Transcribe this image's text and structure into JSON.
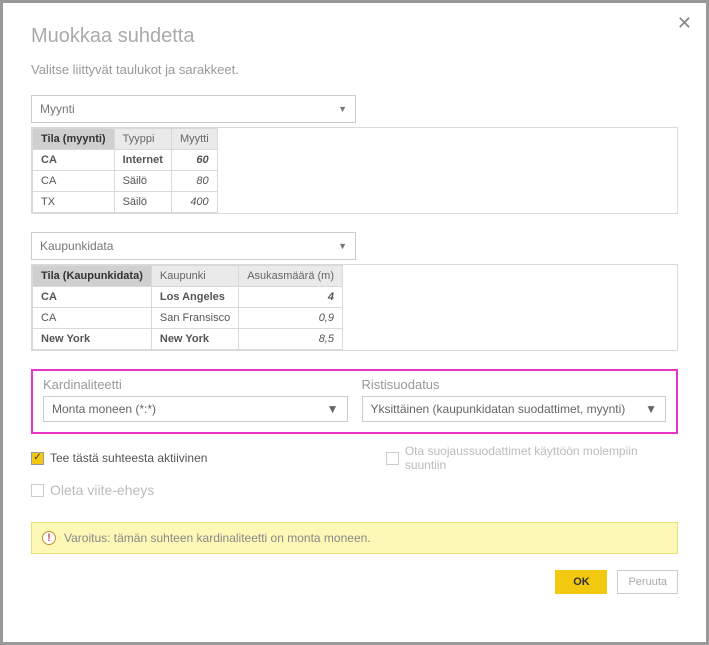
{
  "dialog": {
    "title": "Muokkaa suhdetta",
    "subtitle": "Valitse liittyvät taulukot ja sarakkeet."
  },
  "table1": {
    "dropdown": "Myynti",
    "headers": [
      "Tila (myynti)",
      "Tyyppi",
      "Myytti"
    ],
    "rows": [
      {
        "c0": "CA",
        "c1": "Internet",
        "c2": "60"
      },
      {
        "c0": "CA",
        "c1": "Säilö",
        "c2": "80"
      },
      {
        "c0": "TX",
        "c1": "Säilö",
        "c2": "400"
      }
    ]
  },
  "table2": {
    "dropdown": "Kaupunkidata",
    "headers": [
      "Tila (Kaupunkidata)",
      "Kaupunki",
      "Asukasmäärä (m)"
    ],
    "rows": [
      {
        "c0": "CA",
        "c1": "Los Angeles",
        "c2": "4"
      },
      {
        "c0": "CA",
        "c1": "San Fransisco",
        "c2": "0,9"
      },
      {
        "c0": "New York",
        "c1": "New York",
        "c2": "8,5"
      }
    ]
  },
  "cardinality": {
    "label": "Kardinaliteetti",
    "value": "Monta moneen (*:*)"
  },
  "crossfilter": {
    "label": "Ristisuodatus",
    "value": "Yksittäinen (kaupunkidatan suodattimet, myynti)"
  },
  "checkboxes": {
    "active": "Tee tästä suhteesta aktiivinen",
    "security": "Ota suojaussuodattimet käyttöön molempiin suuntiin",
    "integrity": "Oleta viite-eheys"
  },
  "warning": "Varoitus: tämän suhteen kardinaliteetti on monta moneen.",
  "buttons": {
    "ok": "OK",
    "cancel": "Peruuta"
  }
}
